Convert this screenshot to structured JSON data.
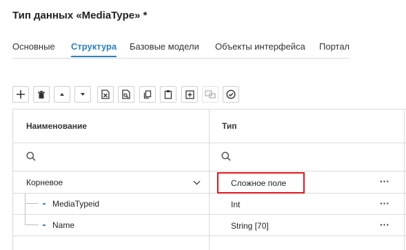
{
  "page": {
    "title": "Тип данных «MediaType» *"
  },
  "tabs": [
    {
      "label": "Основные",
      "active": false
    },
    {
      "label": "Структура",
      "active": true
    },
    {
      "label": "Базовые модели",
      "active": false
    },
    {
      "label": "Объекты интерфейса",
      "active": false
    },
    {
      "label": "Портал",
      "active": false
    }
  ],
  "toolbar": {
    "buttons": [
      {
        "icon": "plus-icon"
      },
      {
        "icon": "trash-icon"
      },
      {
        "icon": "arrow-up-icon"
      },
      {
        "icon": "arrow-down-icon"
      },
      {
        "icon": "excel-export-icon"
      },
      {
        "icon": "document-search-icon"
      },
      {
        "icon": "copy-icon"
      },
      {
        "icon": "paste-icon"
      },
      {
        "icon": "expand-all-icon"
      },
      {
        "icon": "move-disabled-icon"
      },
      {
        "icon": "check-circle-icon"
      }
    ]
  },
  "grid": {
    "columns": [
      "Наименование",
      "Тип"
    ],
    "rows": [
      {
        "name": "Корневое",
        "type": "Сложное поле",
        "expandable": true,
        "highlighted": true
      },
      {
        "name": "MediaTypeid",
        "type": "Int"
      },
      {
        "name": "Name",
        "type": "String [70]"
      }
    ],
    "row_actions": "···"
  },
  "colors": {
    "accent": "#2a7fc0",
    "highlight_border": "#e0121a",
    "grid_line": "#d9d9d9"
  }
}
